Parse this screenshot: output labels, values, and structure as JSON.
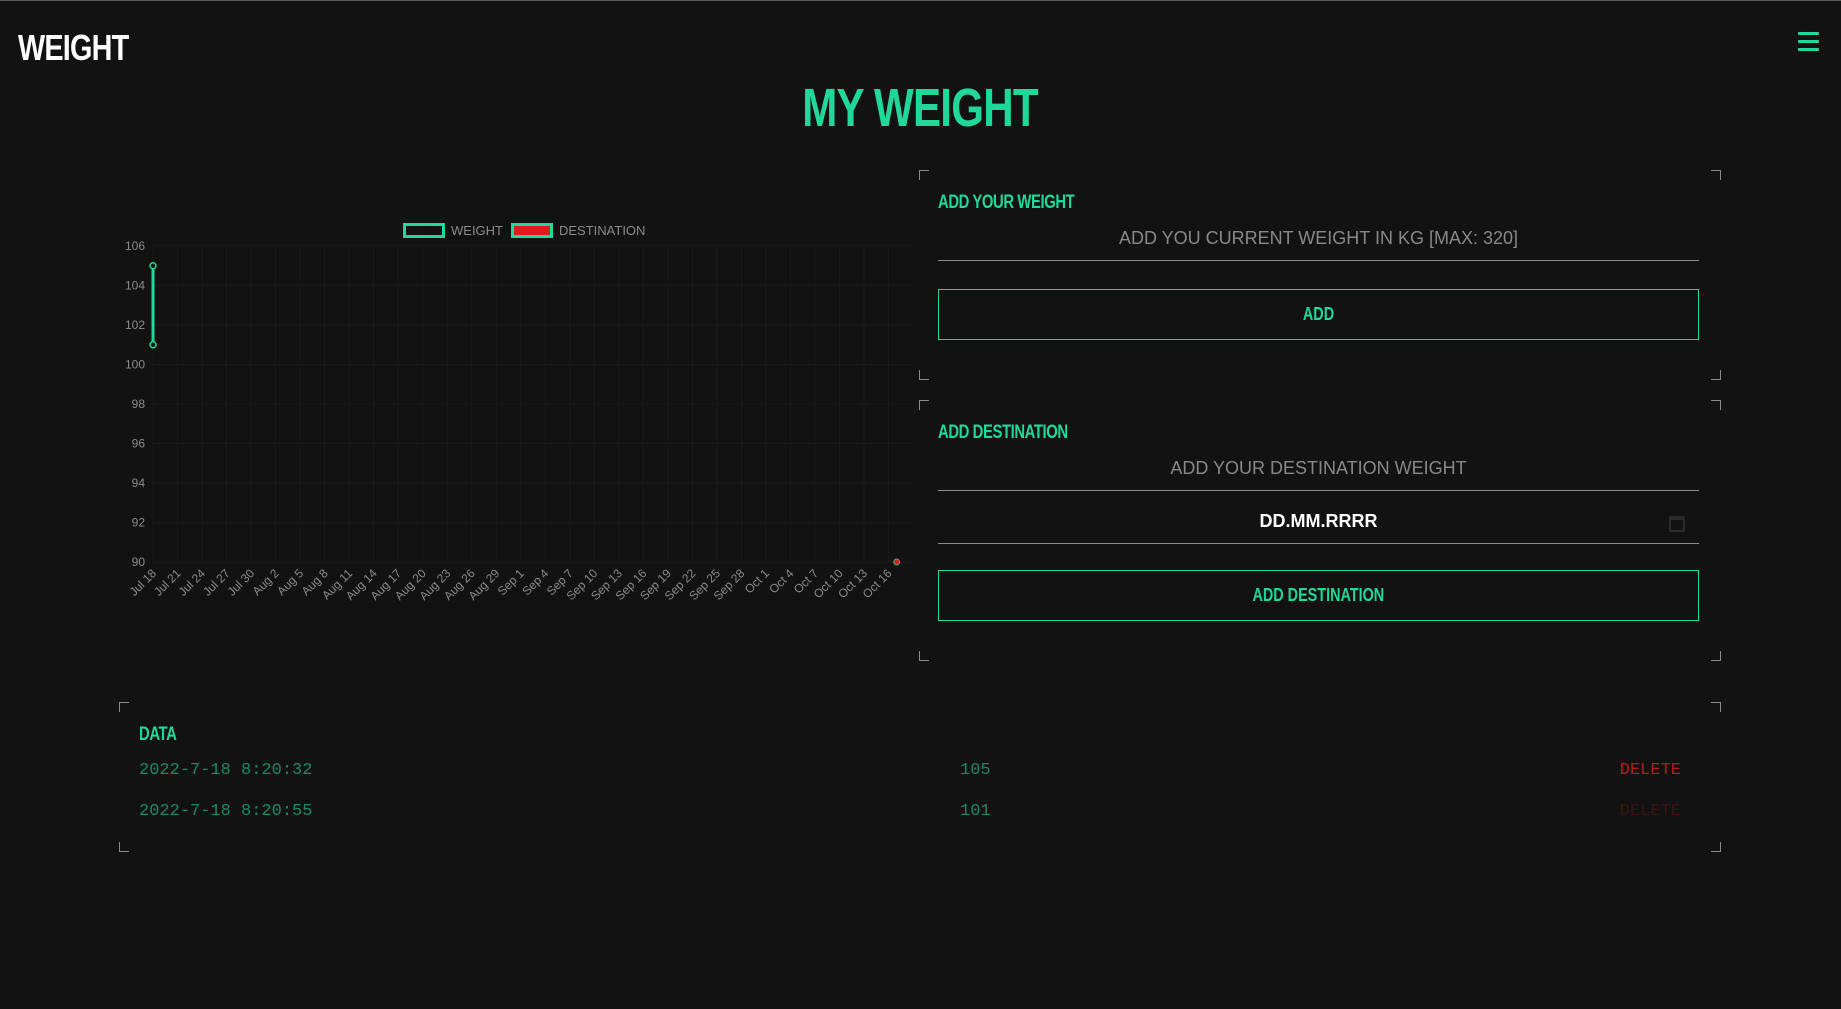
{
  "header": {
    "logo": "WEIGHT",
    "menu_icon": "hamburger-menu-icon",
    "page_title": "MY WEIGHT"
  },
  "colors": {
    "background": "#121212",
    "accent": "#1fd89a",
    "danger": "#e11b1b",
    "muted_text": "#888888"
  },
  "chart_data": {
    "type": "line",
    "legend": [
      "WEIGHT",
      "DESTINATION"
    ],
    "legend_placement": "top-center",
    "grid": true,
    "ylim": [
      90,
      106
    ],
    "y_ticks": [
      "106",
      "104",
      "102",
      "100",
      "98",
      "96",
      "94",
      "92",
      "90"
    ],
    "x_ticks": [
      "Jul 18",
      "Jul 21",
      "Jul 24",
      "Jul 27",
      "Jul 30",
      "Aug 2",
      "Aug 5",
      "Aug 8",
      "Aug 11",
      "Aug 14",
      "Aug 17",
      "Aug 20",
      "Aug 23",
      "Aug 26",
      "Aug 29",
      "Sep 1",
      "Sep 4",
      "Sep 7",
      "Sep 10",
      "Sep 13",
      "Sep 16",
      "Sep 19",
      "Sep 22",
      "Sep 25",
      "Sep 28",
      "Oct 1",
      "Oct 4",
      "Oct 7",
      "Oct 10",
      "Oct 13",
      "Oct 16"
    ],
    "series": [
      {
        "name": "WEIGHT",
        "color": "#1fd89a",
        "points": [
          {
            "x": "Jul 18",
            "y": 105
          },
          {
            "x": "Jul 18",
            "y": 101
          }
        ]
      },
      {
        "name": "DESTINATION",
        "color": "#e11b1b",
        "points": [
          {
            "x": "Oct 17",
            "y": 90
          }
        ]
      }
    ]
  },
  "add_weight": {
    "heading": "ADD YOUR WEIGHT",
    "placeholder": "ADD YOU CURRENT WEIGHT IN KG [MAX: 320]",
    "button_label": "ADD"
  },
  "add_destination": {
    "heading": "ADD DESTINATION",
    "weight_placeholder": "ADD YOUR DESTINATION WEIGHT",
    "date_placeholder": "DD.MM.RRRR",
    "calendar_icon": "calendar-icon",
    "button_label": "ADD DESTINATION"
  },
  "data_table": {
    "heading": "DATA",
    "rows": [
      {
        "date": "2022-7-18 8:20:32",
        "value": "105",
        "action": "DELETE"
      },
      {
        "date": "2022-7-18 8:20:55",
        "value": "101",
        "action": "DELETE"
      }
    ]
  }
}
